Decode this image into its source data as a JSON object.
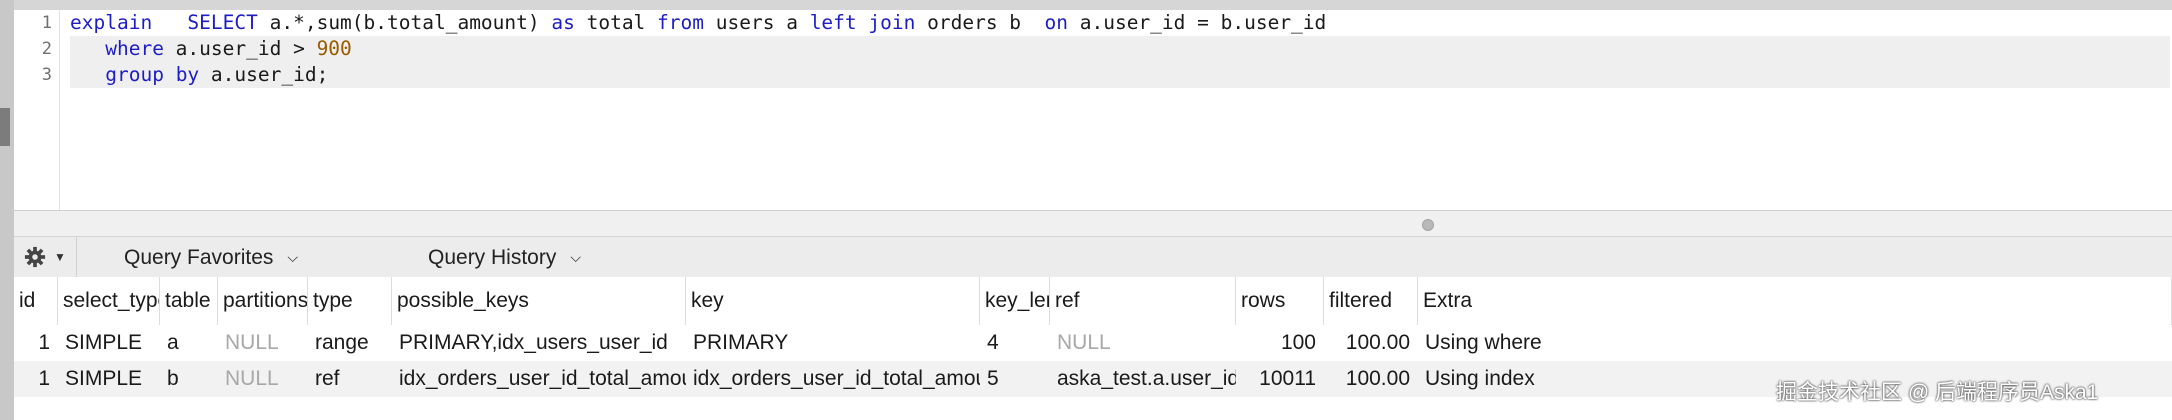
{
  "editor": {
    "line_numbers": [
      "1",
      "2",
      "3"
    ],
    "lines": [
      [
        {
          "t": "explain",
          "c": "kw"
        },
        {
          "t": "   "
        },
        {
          "t": "SELECT",
          "c": "kw"
        },
        {
          "t": " a.*,sum(b.total_amount) "
        },
        {
          "t": "as",
          "c": "kw"
        },
        {
          "t": " total "
        },
        {
          "t": "from",
          "c": "kw"
        },
        {
          "t": " users a "
        },
        {
          "t": "left",
          "c": "kw"
        },
        {
          "t": " "
        },
        {
          "t": "join",
          "c": "kw"
        },
        {
          "t": " orders b  "
        },
        {
          "t": "on",
          "c": "kw"
        },
        {
          "t": " a.user_id = b.user_id"
        }
      ],
      [
        {
          "t": "   "
        },
        {
          "t": "where",
          "c": "kw"
        },
        {
          "t": " a.user_id > "
        },
        {
          "t": "900",
          "c": "num"
        }
      ],
      [
        {
          "t": "   "
        },
        {
          "t": "group",
          "c": "kw"
        },
        {
          "t": " "
        },
        {
          "t": "by",
          "c": "kw"
        },
        {
          "t": " a.user_id;"
        }
      ]
    ]
  },
  "toolbar": {
    "query_favorites_label": "Query Favorites",
    "query_history_label": "Query History",
    "gear_icon": "gear-icon",
    "dropdown_icon": "chevron-down-icon"
  },
  "results": {
    "columns": [
      "id",
      "select_type",
      "table",
      "partitions",
      "type",
      "possible_keys",
      "key",
      "key_len",
      "ref",
      "rows",
      "filtered",
      "Extra"
    ],
    "rows": [
      [
        "1",
        "SIMPLE",
        "a",
        "NULL",
        "range",
        "PRIMARY,idx_users_user_id",
        "PRIMARY",
        "4",
        "NULL",
        "100",
        "100.00",
        "Using where"
      ],
      [
        "1",
        "SIMPLE",
        "b",
        "NULL",
        "ref",
        "idx_orders_user_id_total_amount",
        "idx_orders_user_id_total_amount",
        "5",
        "aska_test.a.user_id",
        "10011",
        "100.00",
        "Using index"
      ]
    ]
  },
  "watermark": "掘金技术社区 @ 后端程序员Aska1",
  "colors": {
    "keyword": "#1d1dc8",
    "number": "#9a5b00",
    "null_value": "#a8a8a8",
    "row_alt": "#f2f2f2"
  }
}
